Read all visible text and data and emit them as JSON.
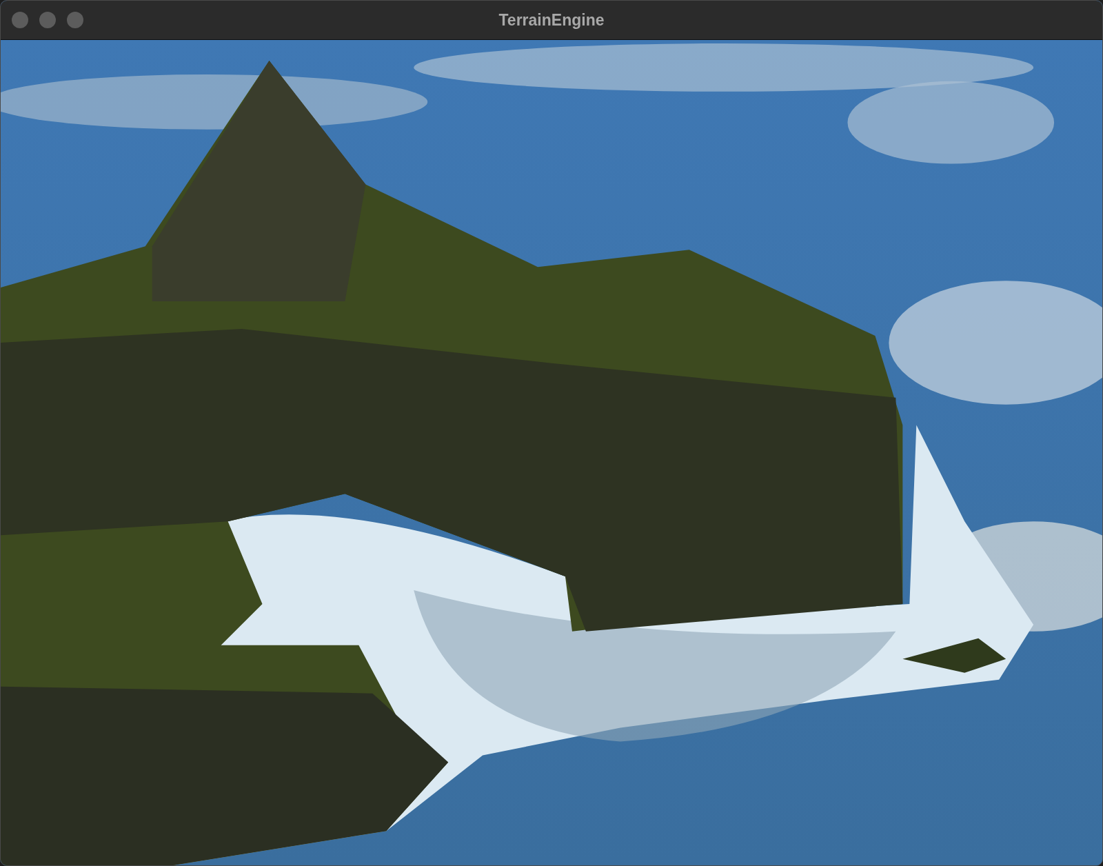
{
  "window": {
    "title": "TerrainEngine"
  }
}
